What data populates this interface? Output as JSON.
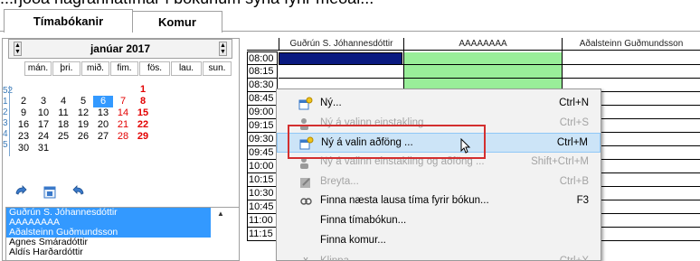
{
  "top_caption_fragment": "...rjóða nágrannatímar í bókunum sýna fyrir meðal...",
  "tabs": [
    {
      "label": "Tímabókanir",
      "active": true
    },
    {
      "label": "Komur",
      "active": false
    }
  ],
  "calendar": {
    "month_title": "janúar 2017",
    "day_headers": [
      "mán.",
      "þri.",
      "mið.",
      "fim.",
      "fös.",
      "lau.",
      "sun."
    ],
    "week_numbers": [
      "52",
      "1",
      "2",
      "3",
      "4",
      "5"
    ],
    "weeks": [
      [
        "",
        "",
        "",
        "",
        "",
        "",
        "1"
      ],
      [
        "2",
        "3",
        "4",
        "5",
        "6",
        "7",
        "8"
      ],
      [
        "9",
        "10",
        "11",
        "12",
        "13",
        "14",
        "15"
      ],
      [
        "16",
        "17",
        "18",
        "19",
        "20",
        "21",
        "22"
      ],
      [
        "23",
        "24",
        "25",
        "26",
        "27",
        "28",
        "29"
      ],
      [
        "30",
        "31",
        "",
        "",
        "",
        "",
        ""
      ]
    ],
    "selected_day": "6"
  },
  "people": [
    {
      "name": "Guðrún S. Jóhannesdóttir",
      "selected": true
    },
    {
      "name": "AAAAAAAA",
      "selected": true
    },
    {
      "name": "Aðalsteinn Guðmundsson",
      "selected": true
    },
    {
      "name": "Agnes Smáradóttir",
      "selected": false
    },
    {
      "name": "Aldís Harðardóttir",
      "selected": false
    }
  ],
  "schedule": {
    "columns": [
      "Guðrún S. Jóhannesdóttir",
      "AAAAAAAA",
      "Aðalsteinn Guðmundsson"
    ],
    "times": [
      "08:00",
      "08:15",
      "08:30",
      "08:45",
      "09:00",
      "09:15",
      "09:30",
      "09:45",
      "10:00",
      "10:15",
      "10:30",
      "10:45",
      "11:00",
      "11:15"
    ],
    "colors": {
      "navy_block": "#0a1a80",
      "green_block": "#99ee99"
    }
  },
  "context_menu": [
    {
      "label": "Ný...",
      "shortcut": "Ctrl+N",
      "enabled": true,
      "highlighted": false,
      "icon": "calendar-new-icon"
    },
    {
      "label": "Ný á valinn einstakling",
      "shortcut": "Ctrl+S",
      "enabled": false,
      "highlighted": false,
      "icon": "person-icon"
    },
    {
      "label": "Ný á valin aðföng ...",
      "shortcut": "Ctrl+M",
      "enabled": true,
      "highlighted": true,
      "icon": "calendar-new-icon"
    },
    {
      "label": "Ný á valinn einstakling og aðföng ...",
      "shortcut": "Shift+Ctrl+M",
      "enabled": false,
      "highlighted": false,
      "icon": "person-icon"
    },
    {
      "label": "Breyta...",
      "shortcut": "Ctrl+B",
      "enabled": false,
      "highlighted": false,
      "icon": "edit-icon"
    },
    {
      "label": "Finna næsta lausa tíma fyrir bókun...",
      "shortcut": "F3",
      "enabled": true,
      "highlighted": false,
      "icon": "find-icon"
    },
    {
      "label": "Finna tímabókun...",
      "shortcut": "",
      "enabled": true,
      "highlighted": false,
      "icon": ""
    },
    {
      "label": "Finna komur...",
      "shortcut": "",
      "enabled": true,
      "highlighted": false,
      "icon": ""
    },
    {
      "label": "Klippa",
      "shortcut": "Ctrl+X",
      "enabled": false,
      "highlighted": false,
      "icon": "cut-icon"
    }
  ]
}
